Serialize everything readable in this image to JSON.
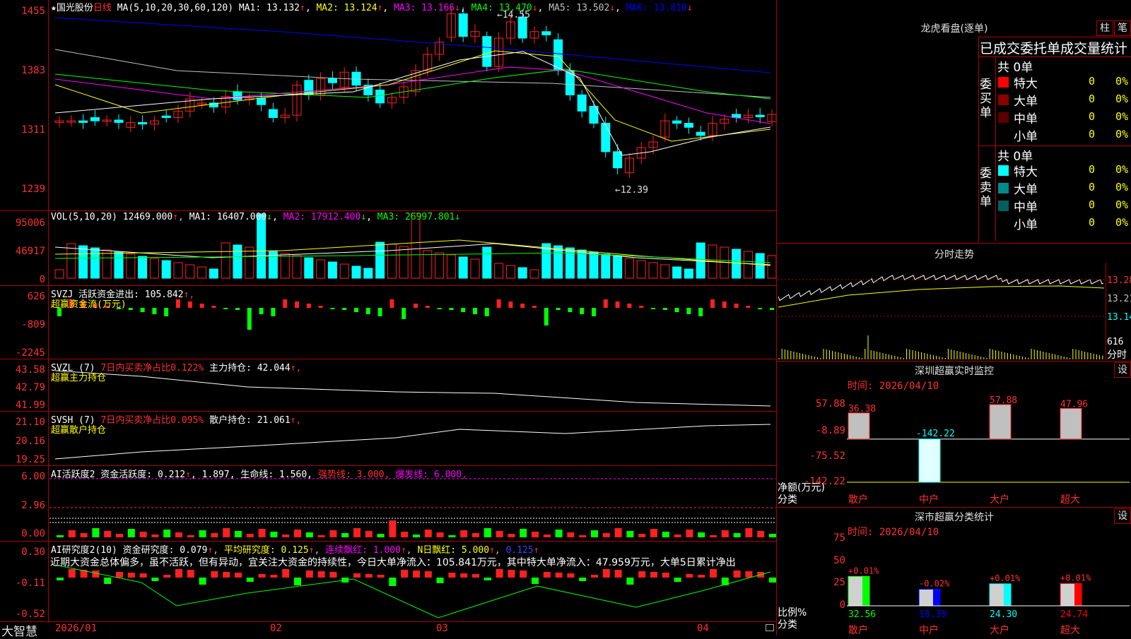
{
  "stock": {
    "star": "★",
    "name": "国光股份",
    "period": "日线"
  },
  "colors": {
    "up": "#ff2020",
    "down": "#00ffff",
    "bg": "#000000",
    "frame": "#b00000",
    "ma1": "#ffffff",
    "ma2": "#ffff00",
    "ma3": "#ff00ff",
    "ma4": "#00ff00",
    "ma5": "#c0c0c0",
    "ma6": "#0000ff"
  },
  "price_panel": {
    "header_prefix": "MA(5,10,20,30,60,120)",
    "ma": [
      {
        "label": "MA1:",
        "value": "13.132",
        "arrow": "↑",
        "color": "#ffffff"
      },
      {
        "label": "MA2:",
        "value": "13.124",
        "arrow": "↑",
        "color": "#ffff00"
      },
      {
        "label": "MA3:",
        "value": "13.166",
        "arrow": "↓",
        "color": "#ff00ff"
      },
      {
        "label": "MA4:",
        "value": "13.470",
        "arrow": "↓",
        "color": "#00ff00"
      },
      {
        "label": "MA5:",
        "value": "13.502",
        "arrow": "↓",
        "color": "#c0c0c0"
      },
      {
        "label": "MA6:",
        "value": "13.810",
        "arrow": "↓",
        "color": "#0000ff"
      }
    ],
    "y_ticks": [
      "1455",
      "1383",
      "1311",
      "1239"
    ],
    "high_label": "14.55",
    "low_label": "12.39"
  },
  "vol_panel": {
    "header": "VOL(5,10,20)",
    "value": "12469.000",
    "arrow": "↑",
    "ma": [
      {
        "label": "MA1:",
        "value": "16407.000",
        "arrow": "↓",
        "color": "#ffffff"
      },
      {
        "label": "MA2:",
        "value": "17912.400",
        "arrow": "↓",
        "color": "#ff00ff"
      },
      {
        "label": "MA3:",
        "value": "26997.801",
        "arrow": "↓",
        "color": "#00ff00"
      }
    ],
    "y_ticks": [
      "95006",
      "46917",
      "0"
    ]
  },
  "svzj_panel": {
    "line1": "SVZJ  活跃资金进出: 105.842",
    "arrow": "↑,",
    "line2": "超赢资金流(万元)",
    "y_ticks": [
      "626",
      "-809",
      "-2245"
    ]
  },
  "svzl_panel": {
    "name": "SVZL (7)",
    "desc": "7日内买卖净占比0.122%",
    "hold": "主力持仓: 42.044",
    "arrow": "↑,",
    "line2": "超赢主力持仓",
    "y_ticks": [
      "43.58",
      "42.79",
      "41.99"
    ]
  },
  "svsh_panel": {
    "name": "SVSH (7)",
    "desc": "7日内买卖净占比0.095%",
    "hold": "散户持仓: 21.061",
    "arrow": "↑,",
    "line2": "超赢散户持仓",
    "y_ticks": [
      "21.10",
      "20.16",
      "19.25"
    ]
  },
  "ai_active_panel": {
    "text1": "AI活跃度2 资金活跃度: 0.212",
    "a1": "↑",
    "text2": ", 1.897, 生命线: 1.560,",
    "strong": "强势线: 3.000,",
    "burst": "爆发线: 6.000,",
    "y_ticks": [
      "6.00",
      "2.96",
      "0.00"
    ]
  },
  "ai_research_panel": {
    "p1": "AI研究度2(10) 资金研究度: 0.079",
    "a1": "↑",
    "p2": "平均研究度: 0.125",
    "a2": "↑",
    "p3": "连续飘红: 1.000",
    "a3": "↑",
    "p4": "N日飘红: 5.000",
    "a4": "↑",
    "p5": "0.125",
    "a5": "↑",
    "comment": "近期大资金总体偏多，虽不活跃，但有异动，宜关注大资金的持续性，今日大单净流入：105.841万元，其中特大单净流入：47.959万元，大单5日累计净出",
    "y_ticks": [
      "0.30",
      "-0.11",
      "-0.52"
    ]
  },
  "bottom_bar": {
    "brand": "大智慧",
    "dates": [
      "2026/01",
      "02",
      "03",
      "04"
    ]
  },
  "lhb": {
    "title": "龙虎看盘(逐单)",
    "btn_zhu": "柱",
    "btn_bi": "笔",
    "subtitle": "已成交委托单成交量统计",
    "buy": {
      "side": "委买单",
      "total": "共 0单",
      "rows": [
        {
          "label": "特大",
          "count": "0",
          "pct": "0%",
          "color": "#ff0000"
        },
        {
          "label": "大单",
          "count": "0",
          "pct": "0%",
          "color": "#8b0000"
        },
        {
          "label": "中单",
          "count": "0",
          "pct": "0%",
          "color": "#5a0000"
        },
        {
          "label": "小单",
          "count": "0",
          "pct": "0%",
          "color": "#000000"
        }
      ]
    },
    "sell": {
      "side": "委卖单",
      "total": "共 0单",
      "rows": [
        {
          "label": "特大",
          "count": "0",
          "pct": "0%",
          "color": "#00ffff"
        },
        {
          "label": "大单",
          "count": "0",
          "pct": "0%",
          "color": "#008b8b"
        },
        {
          "label": "中单",
          "count": "0",
          "pct": "0%",
          "color": "#006060"
        },
        {
          "label": "小单",
          "count": "0",
          "pct": "0%",
          "color": "#000000"
        }
      ]
    }
  },
  "intraday": {
    "title": "分时走势",
    "ticks": [
      "13.28",
      "13.21",
      "13.14"
    ],
    "vol_tick": "616",
    "vol_label": "分时"
  },
  "monitor": {
    "title": "深圳超赢实时监控",
    "btn": "设",
    "time": "时间: 2026/04/10",
    "y_ticks": [
      "57.88",
      "-8.89",
      "-75.52",
      "-142.22"
    ],
    "unit": "净额(万元)",
    "unit2": "分类",
    "chart_data": {
      "type": "bar",
      "categories": [
        "散户",
        "中户",
        "大户",
        "超大"
      ],
      "values": [
        36.38,
        -142.22,
        57.88,
        47.96
      ],
      "ylim": [
        -142.22,
        57.88
      ]
    }
  },
  "classify": {
    "title": "深市超赢分类统计",
    "btn": "设",
    "time": "时间: 2026/04/10",
    "y_ticks": [
      "75",
      "50",
      "25",
      "0"
    ],
    "unit": "比例%",
    "unit2": "分类",
    "chart_data": {
      "type": "bar",
      "categories": [
        "散户",
        "中户",
        "大户",
        "超大"
      ],
      "values": [
        32.56,
        18.39,
        24.3,
        24.74
      ],
      "changes": [
        "+0.01%",
        "-0.02%",
        "+0.01%",
        "+0.01%"
      ],
      "ylim": [
        0,
        75
      ]
    }
  }
}
